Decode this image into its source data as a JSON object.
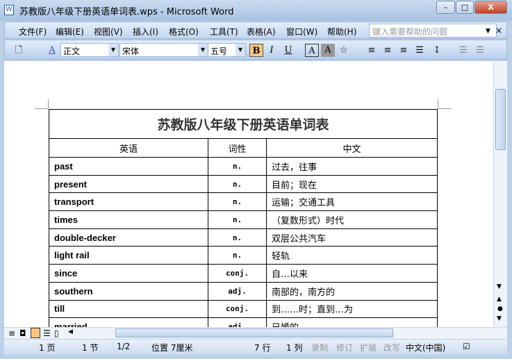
{
  "window": {
    "title": "苏教版八年级下册英语单词表.wps - Microsoft Word",
    "app_icon": "W"
  },
  "menu": [
    "文件(F)",
    "编辑(E)",
    "视图(V)",
    "插入(I)",
    "格式(O)",
    "工具(T)",
    "表格(A)",
    "窗口(W)",
    "帮助(H)"
  ],
  "help_placeholder": "键入需要帮助的问题",
  "toolbar": {
    "style": "正文",
    "font": "宋体",
    "size": "五号",
    "bold": "B",
    "italic": "I",
    "underline": "U"
  },
  "document": {
    "title": "苏教版八年级下册英语单词表",
    "headers": [
      "英语",
      "词性",
      "中文"
    ],
    "rows": [
      [
        "past",
        "n.",
        "过去，往事"
      ],
      [
        "present",
        "n.",
        "目前；现在"
      ],
      [
        "transport",
        "n.",
        "运输；交通工具"
      ],
      [
        "times",
        "n.",
        "（复数形式）时代"
      ],
      [
        "double-decker",
        "n.",
        "双层公共汽车"
      ],
      [
        "light rail",
        "n.",
        "轻轨"
      ],
      [
        "since",
        "conj.",
        "自…以来"
      ],
      [
        "southern",
        "adj.",
        "南部的，南方的"
      ],
      [
        "till",
        "conj.",
        "到……时；直到…为"
      ],
      [
        "married",
        "adj.",
        "已婚的"
      ]
    ]
  },
  "status": {
    "page": "1 页",
    "section": "1 节",
    "pages": "1/2",
    "position": "位置 7厘米",
    "line": "7 行",
    "col": "1 列",
    "rec": "录制",
    "trk": "修订",
    "ext": "扩展",
    "ovr": "改写",
    "lang": "中文(中国)"
  }
}
